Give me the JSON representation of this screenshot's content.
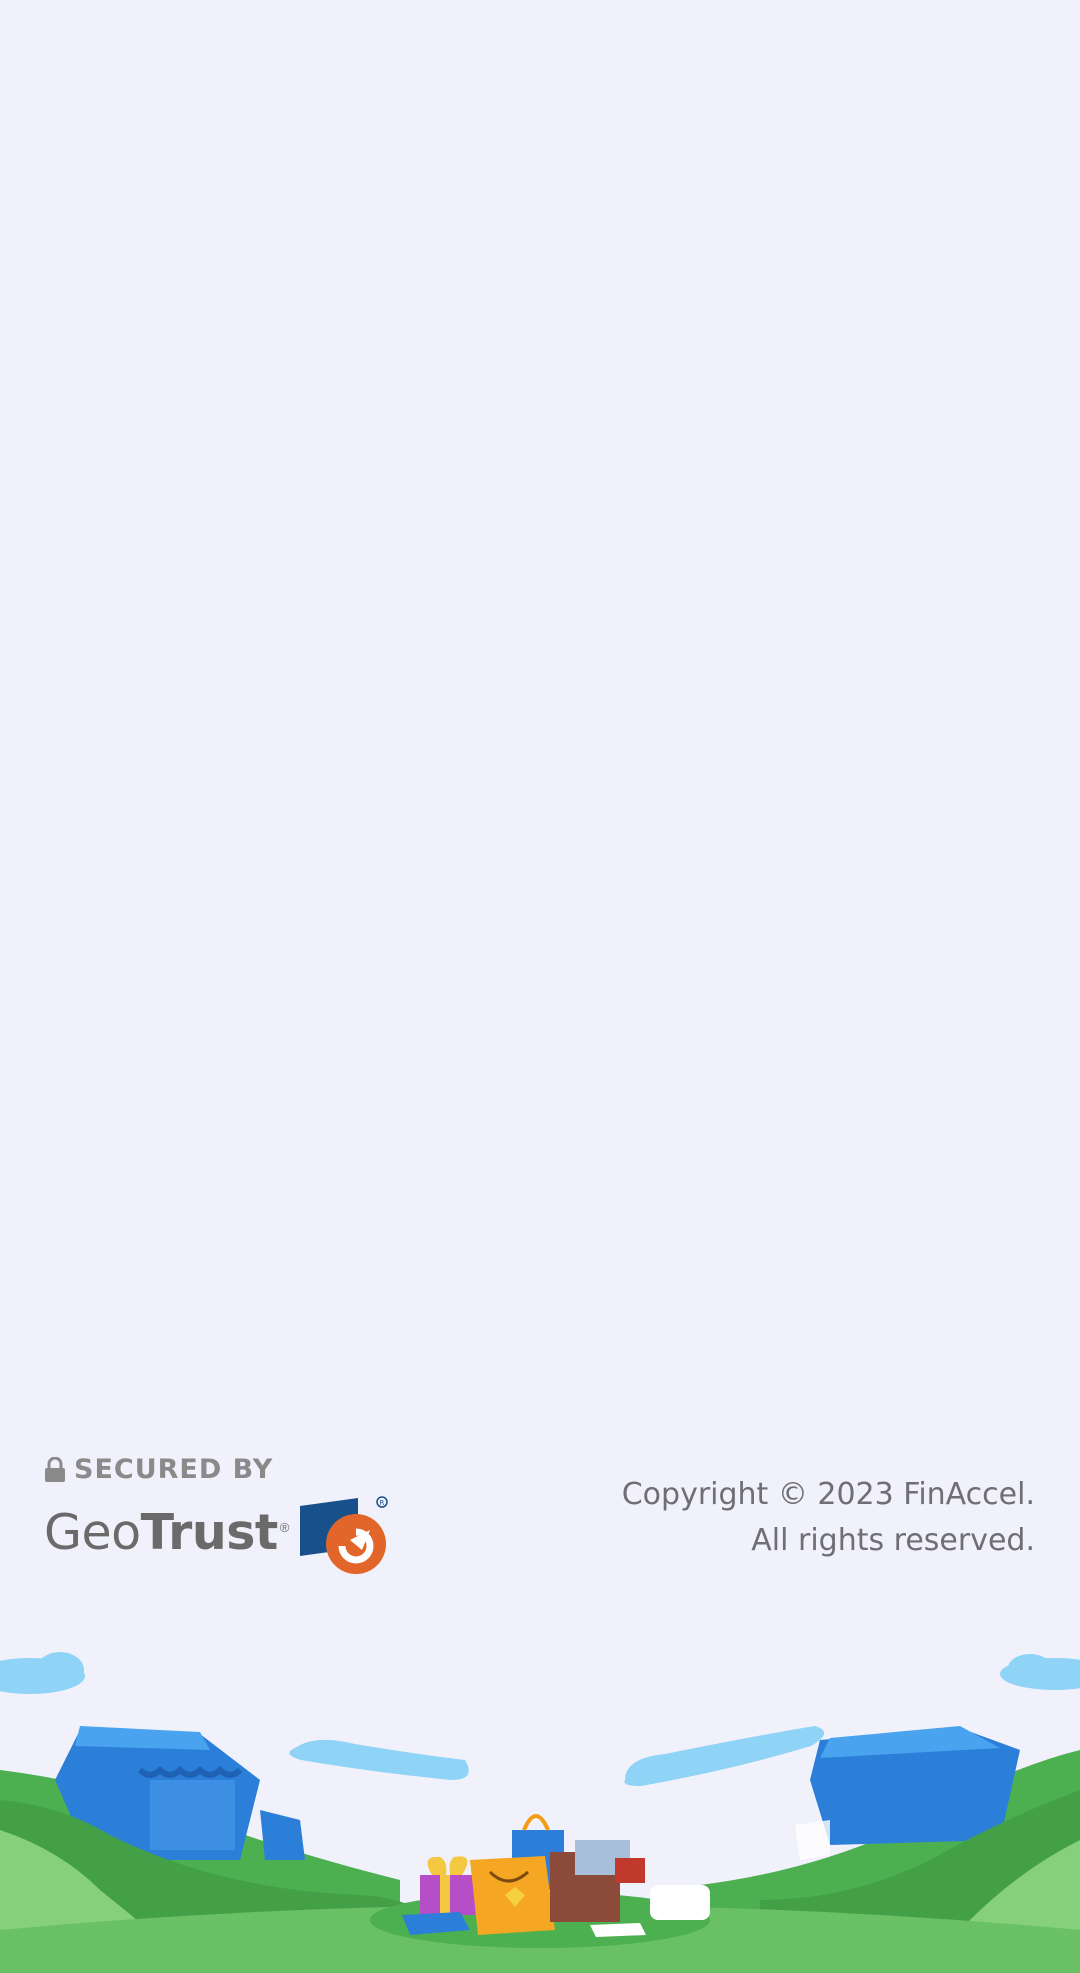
{
  "footer": {
    "badge": {
      "secured_by": "SECURED BY",
      "brand_geo": "Geo",
      "brand_trust": "Trust",
      "registered": "®"
    },
    "copyright_line1": "Copyright © 2023 FinAccel.",
    "copyright_line2": "All rights reserved."
  },
  "colors": {
    "background": "#f1f1fb",
    "text_gray": "#6e6e74",
    "geotrust_blue": "#17508a",
    "geotrust_orange": "#e2652a",
    "grass_green": "#4caf50",
    "store_blue": "#2b7fd8",
    "cloud_blue": "#8fd3f7"
  }
}
